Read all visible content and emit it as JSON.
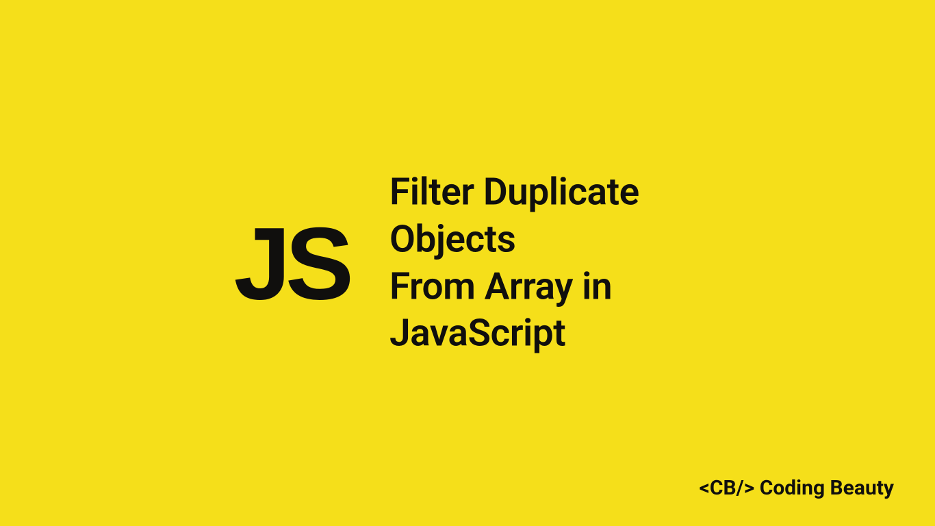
{
  "logo": "JS",
  "title_line1": "Filter Duplicate Objects",
  "title_line2": "From Array in JavaScript",
  "footer": "<CB/> Coding Beauty",
  "colors": {
    "background": "#f5df1a",
    "text": "#100f0d"
  }
}
